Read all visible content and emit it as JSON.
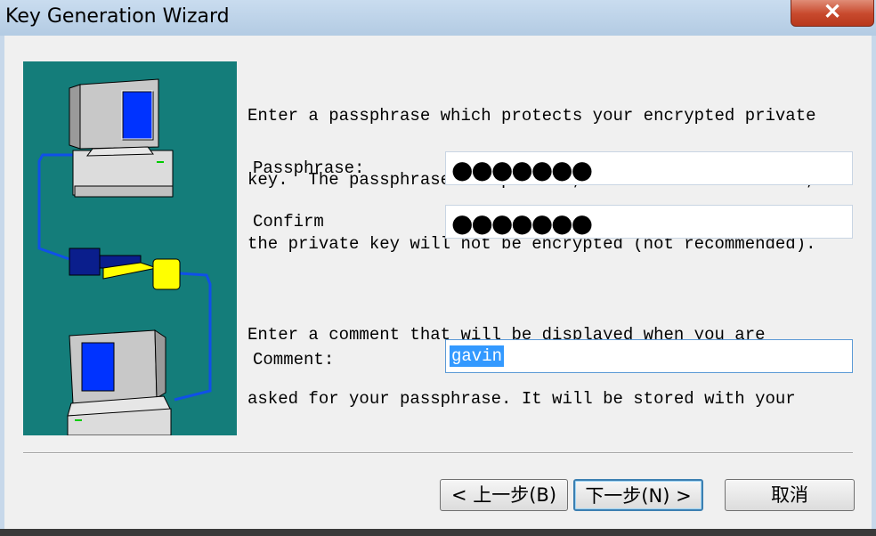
{
  "window": {
    "title": "Key Generation Wizard",
    "close_symbol": "✕"
  },
  "intro": {
    "line1": "Enter a passphrase which protects your encrypted private",
    "line2": "key.  The passphrase is optional, but if it is not used,",
    "line3": "the private key will not be encrypted (not recommended)."
  },
  "passphrase": {
    "label": "Passphrase:",
    "masked": "●●●●●●●"
  },
  "confirm": {
    "label": "Confirm",
    "masked": "●●●●●●●"
  },
  "comment_help": {
    "line1": "Enter a comment that will be displayed when you are",
    "line2": "asked for your passphrase. It will be stored with your"
  },
  "comment": {
    "label": "Comment:",
    "value": "gavin"
  },
  "buttons": {
    "back": "< 上一步(B)",
    "next": "下一步(N) >",
    "cancel": "取消"
  },
  "colors": {
    "panel": "#147d7a",
    "selection": "#3399ff",
    "key_blue": "#0a1e8c",
    "key_yellow": "#ffff00"
  }
}
